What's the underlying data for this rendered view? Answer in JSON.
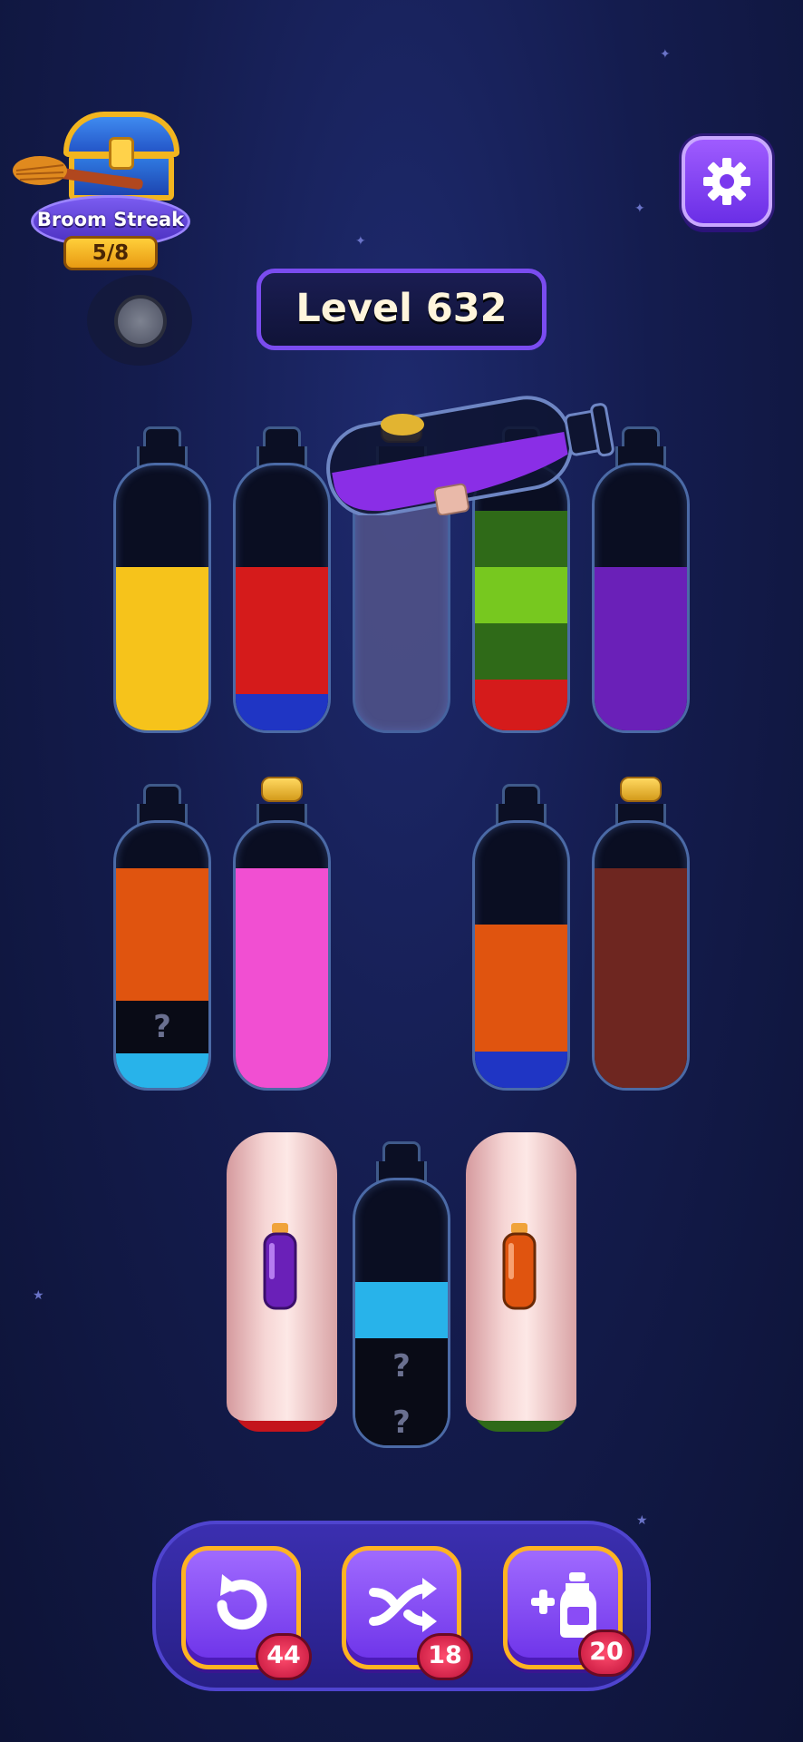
{
  "streak": {
    "label": "Broom Streak",
    "count": "5/8"
  },
  "level": {
    "label": "Level 632"
  },
  "colors": {
    "yellow": "#f6c31b",
    "red": "#d51b1b",
    "blue": "#1f35c4",
    "dark_green": "#2f6a18",
    "lime": "#77c81f",
    "purple": "#6a20b8",
    "orange": "#e0540f",
    "light_blue": "#28b3ea",
    "pink": "#f14fd2",
    "brown": "#6e2620",
    "hidden": "#090b16"
  },
  "bottles_row1": [
    {
      "layers": [
        "yellow",
        "yellow",
        "yellow",
        "yellow"
      ]
    },
    {
      "layers": [
        "red",
        "red",
        "red",
        "blue"
      ]
    },
    {
      "layers": [],
      "state": "lifted-pouring",
      "poured": "purple"
    },
    {
      "layers": [
        "dark_green",
        "lime",
        "dark_green",
        "red"
      ]
    },
    {
      "layers": [
        "purple",
        "purple",
        "purple",
        "purple"
      ]
    }
  ],
  "bottles_row2": [
    {
      "layers": [
        "orange",
        "orange",
        "hidden",
        "light_blue"
      ],
      "hidden_marks": [
        "?"
      ]
    },
    {
      "layers": [
        "pink",
        "pink",
        "pink",
        "pink"
      ],
      "sealed": true
    },
    {
      "layers": [
        "orange",
        "orange",
        "blue"
      ]
    },
    {
      "layers": [
        "brown",
        "brown",
        "brown",
        "brown"
      ],
      "sealed": true
    }
  ],
  "bottles_row3": [
    {
      "covered": true,
      "hint_color": "purple",
      "peek_color": "red"
    },
    {
      "layers": [
        "light_blue",
        "hidden",
        "hidden"
      ],
      "hidden_marks": [
        "?",
        "?"
      ]
    },
    {
      "covered": true,
      "hint_color": "orange",
      "peek_color": "dark_green"
    }
  ],
  "tools": [
    {
      "name": "undo",
      "icon": "undo-icon",
      "count": "44"
    },
    {
      "name": "shuffle",
      "icon": "shuffle-icon",
      "count": "18"
    },
    {
      "name": "add-bottle",
      "icon": "add-bottle-icon",
      "count": "20"
    }
  ]
}
